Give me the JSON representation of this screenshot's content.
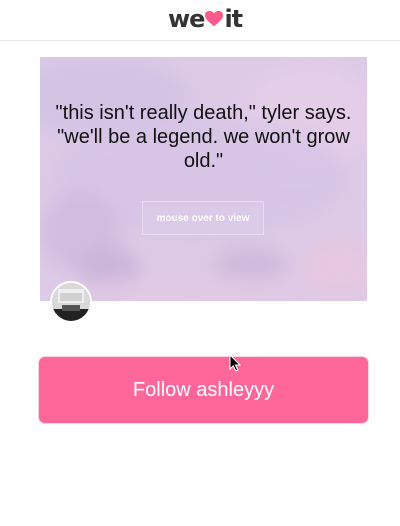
{
  "header": {
    "logo_prefix": "we",
    "logo_suffix": "it",
    "logo_heart_color": "#ff5a8c"
  },
  "card": {
    "quote": "\"this isn't really death,\" tyler says. \"we'll be a legend. we won't grow old.\"",
    "mouse_over_label": "mouse over to view"
  },
  "follow": {
    "label": "Follow ashleyyy",
    "color": "#ff6699"
  }
}
